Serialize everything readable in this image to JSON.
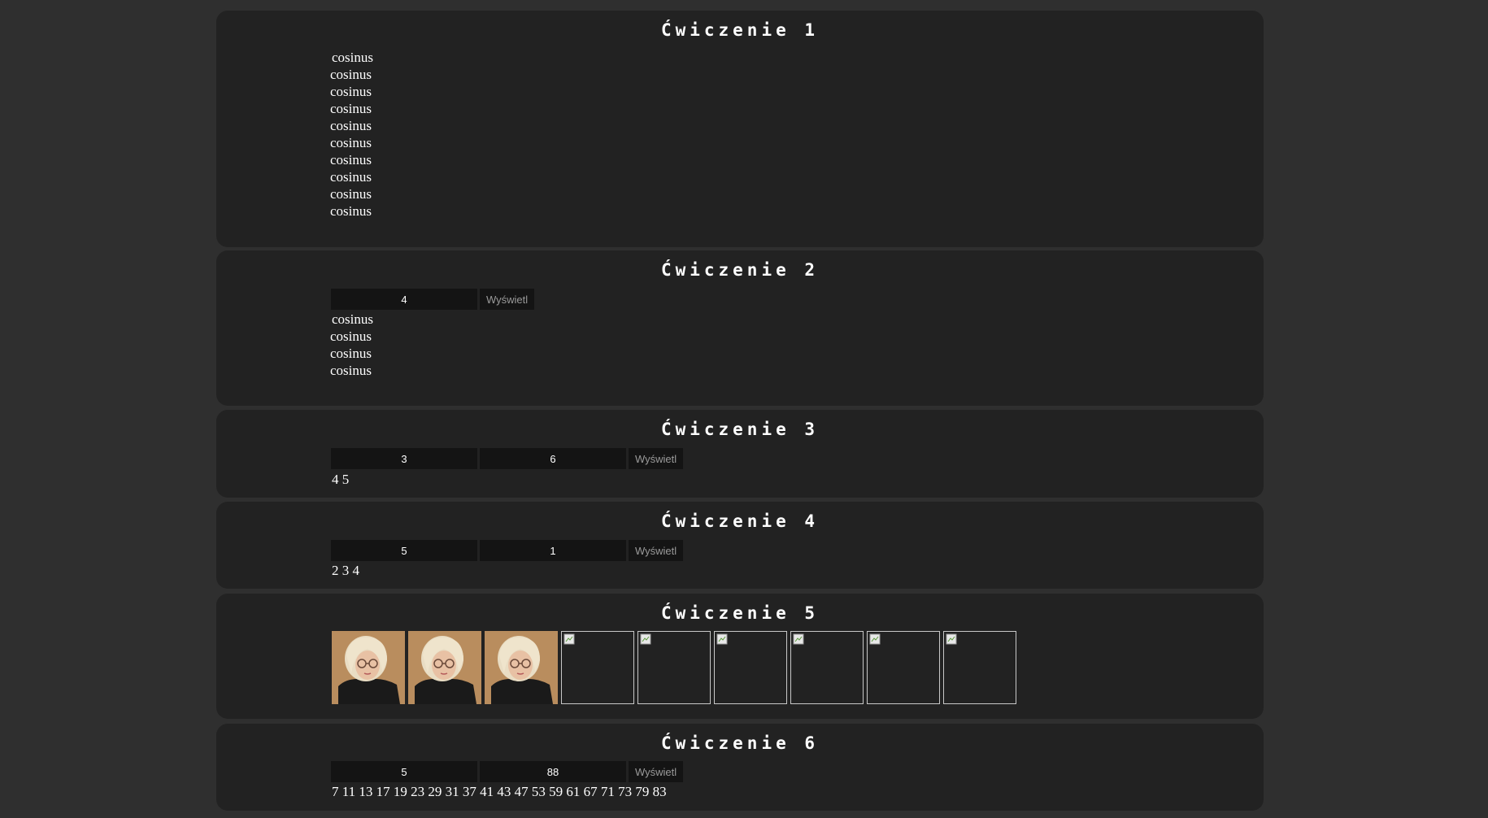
{
  "ex1": {
    "title": "Ćwiczenie 1",
    "lines": [
      "cosinus",
      "cosinus",
      "cosinus",
      "cosinus",
      "cosinus",
      "cosinus",
      "cosinus",
      "cosinus",
      "cosinus",
      "cosinus"
    ]
  },
  "ex2": {
    "title": "Ćwiczenie 2",
    "input_value": "4",
    "button_label": "Wyświetl",
    "lines": [
      "cosinus",
      "cosinus",
      "cosinus",
      "cosinus"
    ]
  },
  "ex3": {
    "title": "Ćwiczenie 3",
    "input1_value": "3",
    "input2_value": "6",
    "button_label": "Wyświetl",
    "result": "4 5"
  },
  "ex4": {
    "title": "Ćwiczenie 4",
    "input1_value": "5",
    "input2_value": "1",
    "button_label": "Wyświetl",
    "result": "2 3 4"
  },
  "ex5": {
    "title": "Ćwiczenie 5",
    "loaded_images": 3,
    "broken_images": 6
  },
  "ex6": {
    "title": "Ćwiczenie 6",
    "input1_value": "5",
    "input2_value": "88",
    "button_label": "Wyświetl",
    "result": "7 11 13 17 19 23 29 31 37 41 43 47 53 59 61 67 71 73 79 83"
  }
}
